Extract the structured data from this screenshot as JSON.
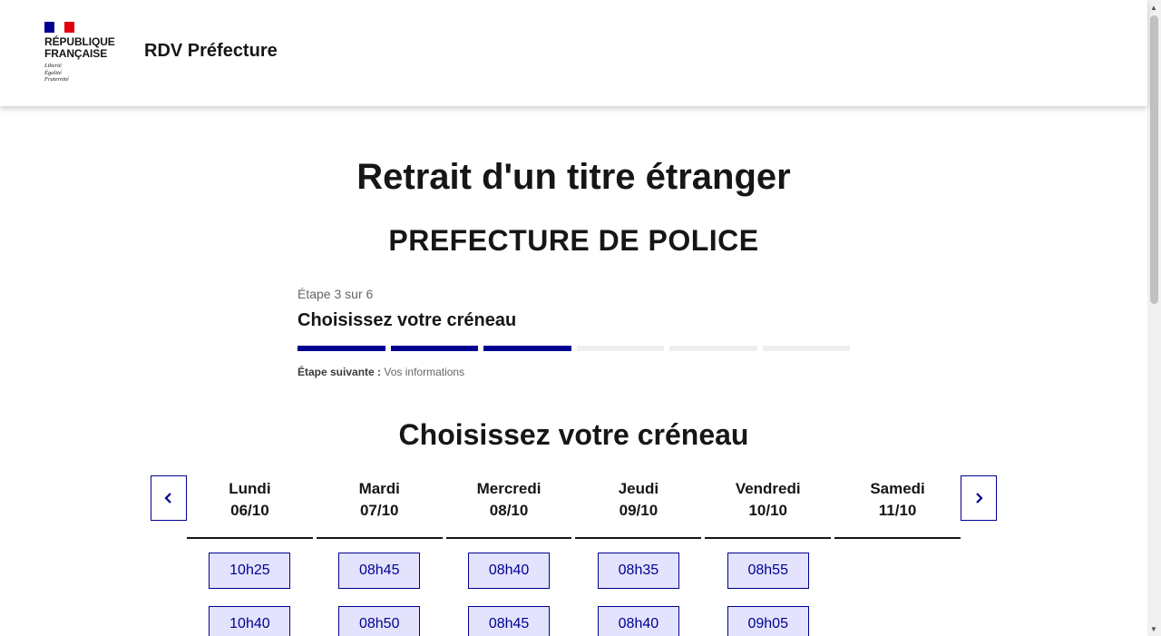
{
  "header": {
    "republic_line1": "République",
    "republic_line2": "Française",
    "motto": [
      "Liberté",
      "Égalité",
      "Fraternité"
    ],
    "service_title": "RDV Préfecture",
    "flag_colors": [
      "#000091",
      "#ffffff",
      "#e1000f"
    ]
  },
  "page": {
    "title": "Retrait d'un titre étranger",
    "subtitle": "PREFECTURE DE POLICE"
  },
  "stepper": {
    "state": "Étape 3 sur 6",
    "title": "Choisissez votre créneau",
    "current_step": 3,
    "total_steps": 6,
    "next_label": "Étape suivante :",
    "next_value": "Vos informations"
  },
  "calendar": {
    "title": "Choisissez votre créneau",
    "prev_icon": "chevron-left-icon",
    "next_icon": "chevron-right-icon",
    "days": [
      {
        "name": "Lundi",
        "date": "06/10",
        "slots": [
          "10h25",
          "10h40"
        ]
      },
      {
        "name": "Mardi",
        "date": "07/10",
        "slots": [
          "08h45",
          "08h50"
        ]
      },
      {
        "name": "Mercredi",
        "date": "08/10",
        "slots": [
          "08h40",
          "08h45"
        ]
      },
      {
        "name": "Jeudi",
        "date": "09/10",
        "slots": [
          "08h35",
          "08h40"
        ]
      },
      {
        "name": "Vendredi",
        "date": "10/10",
        "slots": [
          "08h55",
          "09h05"
        ]
      },
      {
        "name": "Samedi",
        "date": "11/10",
        "slots": []
      }
    ]
  },
  "colors": {
    "accent": "#000091",
    "slot_background": "#e3e3fd",
    "step_inactive": "#eeeeee"
  }
}
